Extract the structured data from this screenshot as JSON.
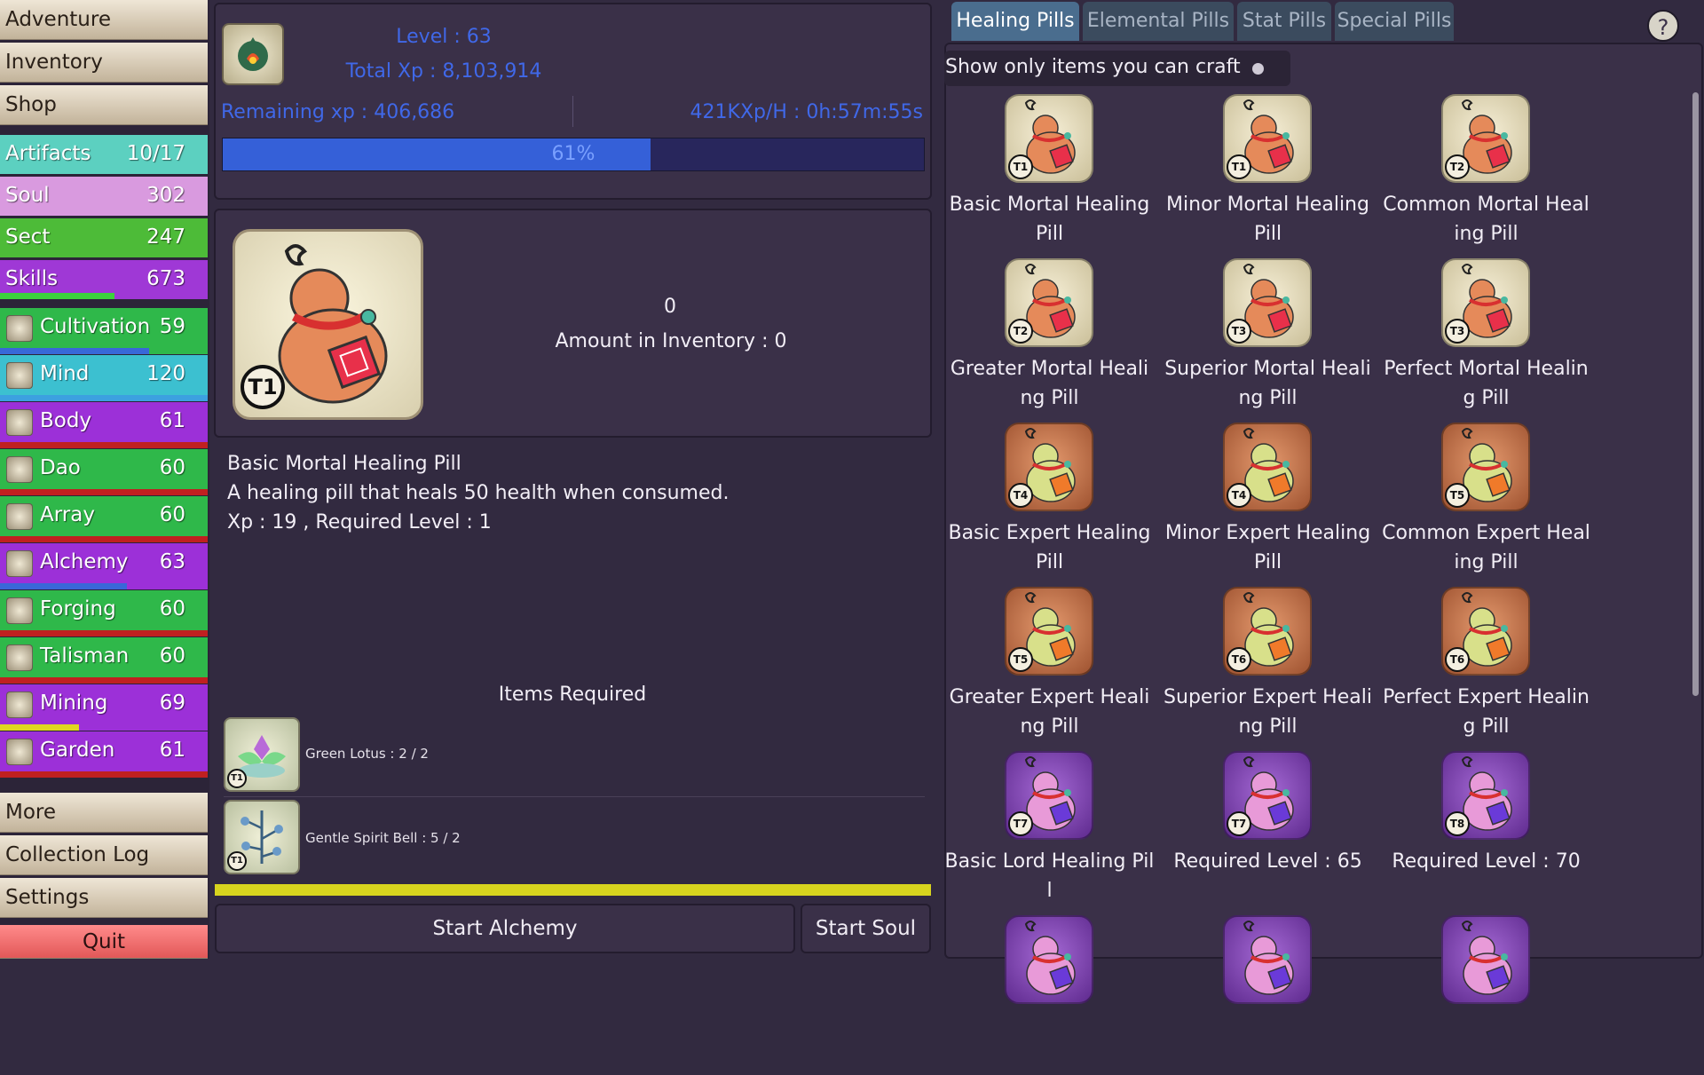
{
  "nav_top": [
    "Adventure",
    "Inventory",
    "Shop"
  ],
  "stats": [
    {
      "label": "Artifacts",
      "value": "10/17",
      "bg": "#5cd0c0",
      "icon": null,
      "bar": null,
      "bar_pct": 0
    },
    {
      "label": "Soul",
      "value": "302",
      "bg": "#d99adf",
      "icon": null,
      "bar": null,
      "bar_pct": 0
    },
    {
      "label": "Sect",
      "value": "247",
      "bg": "#4dbb38",
      "icon": null,
      "bar": null,
      "bar_pct": 0
    },
    {
      "label": "Skills",
      "value": "673",
      "bg": "#9f38d6",
      "icon": null,
      "bar": "#3cd23c",
      "bar_pct": 0.55
    },
    {
      "label": "Cultivation",
      "value": "59",
      "bg": "#2fb84a",
      "icon": "cultivation-icon",
      "bar": "#3868d8",
      "bar_pct": 0.72
    },
    {
      "label": "Mind",
      "value": "120",
      "bg": "#3cc0d0",
      "icon": "mind-icon",
      "bar": "#3ca0e0",
      "bar_pct": 1.0
    },
    {
      "label": "Body",
      "value": "61",
      "bg": "#9c30d8",
      "icon": "body-icon",
      "bar": "#c02020",
      "bar_pct": 1.0
    },
    {
      "label": "Dao",
      "value": "60",
      "bg": "#2fb84a",
      "icon": "dao-icon",
      "bar": "#c02020",
      "bar_pct": 1.0
    },
    {
      "label": "Array",
      "value": "60",
      "bg": "#2fb84a",
      "icon": "array-icon",
      "bar": "#c02020",
      "bar_pct": 1.0
    },
    {
      "label": "Alchemy",
      "value": "63",
      "bg": "#9c30d8",
      "icon": "alchemy-icon",
      "bar": "#3868d8",
      "bar_pct": 0.61
    },
    {
      "label": "Forging",
      "value": "60",
      "bg": "#2fb84a",
      "icon": "forging-icon",
      "bar": "#c02020",
      "bar_pct": 1.0
    },
    {
      "label": "Talisman",
      "value": "60",
      "bg": "#2fb84a",
      "icon": "talisman-icon",
      "bar": "#c02020",
      "bar_pct": 1.0
    },
    {
      "label": "Mining",
      "value": "69",
      "bg": "#9c30d8",
      "icon": "mining-icon",
      "bar": "#e0d820",
      "bar_pct": 0.38
    },
    {
      "label": "Garden",
      "value": "61",
      "bg": "#9c30d8",
      "icon": "garden-icon",
      "bar": "#c02020",
      "bar_pct": 1.0
    }
  ],
  "nav_bottom": [
    "More",
    "Collection Log",
    "Settings"
  ],
  "quit_label": "Quit",
  "level": {
    "level_text": "Level : 63",
    "total_xp_text": "Total Xp : 8,103,914",
    "remaining_text": "Remaining xp : 406,686",
    "rate_text": "421KXp/H : 0h:57m:55s",
    "progress_pct": 61,
    "progress_label": "61%"
  },
  "selected": {
    "count": "0",
    "inventory_text": "Amount in Inventory : 0",
    "name": "Basic Mortal Healing Pill",
    "description": "A healing pill that heals 50 health when consumed.",
    "xp_line": "Xp : 19 , Required Level : 1",
    "items_required_title": "Items Required",
    "tier_badge": "T1"
  },
  "requirements": [
    {
      "text": "Green Lotus : 2 / 2",
      "tier": "T1"
    },
    {
      "text": "Gentle Spirit Bell : 5 / 2",
      "tier": "T1"
    }
  ],
  "actions": {
    "start_alchemy": "Start Alchemy",
    "start_soul": "Start Soul"
  },
  "tabs": [
    "Healing Pills",
    "Elemental Pills",
    "Stat Pills",
    "Special Pills"
  ],
  "active_tab": 0,
  "help_label": "?",
  "craft_toggle_label": "Show only items you can craft",
  "pills": [
    {
      "name": [
        "Basic Mortal Healing",
        "Pill"
      ],
      "tier": "T1",
      "style": "a"
    },
    {
      "name": [
        "Minor Mortal Healing",
        "Pill"
      ],
      "tier": "T1",
      "style": "a"
    },
    {
      "name": [
        "Common Mortal Heal",
        "ing Pill"
      ],
      "tier": "T2",
      "style": "a"
    },
    {
      "name": [
        "Greater Mortal Heali",
        "ng Pill"
      ],
      "tier": "T2",
      "style": "a"
    },
    {
      "name": [
        "Superior Mortal Heali",
        "ng Pill"
      ],
      "tier": "T3",
      "style": "a"
    },
    {
      "name": [
        "Perfect Mortal Healin",
        "g Pill"
      ],
      "tier": "T3",
      "style": "a"
    },
    {
      "name": [
        "Basic Expert Healing",
        "Pill"
      ],
      "tier": "T4",
      "style": "b"
    },
    {
      "name": [
        "Minor Expert Healing",
        "Pill"
      ],
      "tier": "T4",
      "style": "b"
    },
    {
      "name": [
        "Common Expert Heal",
        "ing Pill"
      ],
      "tier": "T5",
      "style": "b"
    },
    {
      "name": [
        "Greater Expert Heali",
        "ng Pill"
      ],
      "tier": "T5",
      "style": "b"
    },
    {
      "name": [
        "Superior Expert Heali",
        "ng Pill"
      ],
      "tier": "T6",
      "style": "b"
    },
    {
      "name": [
        "Perfect Expert Healin",
        "g Pill"
      ],
      "tier": "T6",
      "style": "b"
    },
    {
      "name": [
        "Basic Lord Healing Pil",
        "l"
      ],
      "tier": "T7",
      "style": "c"
    },
    {
      "name": [
        "Required Level : 65"
      ],
      "tier": "T7",
      "style": "c"
    },
    {
      "name": [
        "Required Level : 70"
      ],
      "tier": "T8",
      "style": "c"
    },
    {
      "name": [],
      "tier": "",
      "style": "c"
    },
    {
      "name": [],
      "tier": "",
      "style": "c"
    },
    {
      "name": [],
      "tier": "",
      "style": "c"
    }
  ]
}
